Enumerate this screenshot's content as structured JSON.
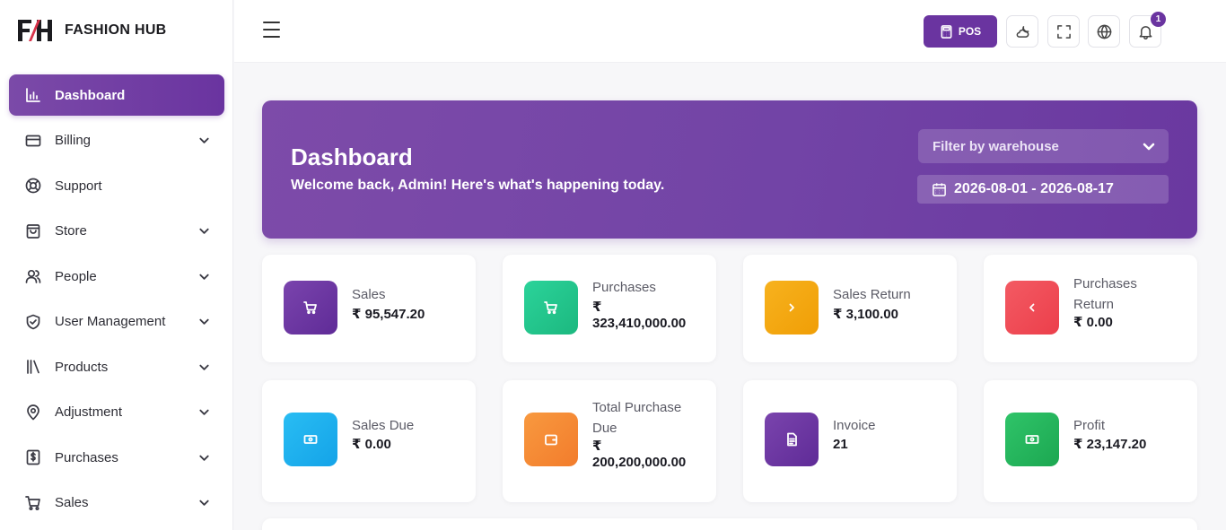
{
  "brand": {
    "logo_text": "FH",
    "name": "FASHION HUB"
  },
  "sidebar": {
    "items": [
      {
        "label": "Dashboard",
        "icon": "bar-chart-icon"
      },
      {
        "label": "Billing",
        "icon": "credit-card-icon"
      },
      {
        "label": "Support",
        "icon": "lifebuoy-icon"
      },
      {
        "label": "Store",
        "icon": "shopping-bag-icon"
      },
      {
        "label": "People",
        "icon": "users-icon"
      },
      {
        "label": "User Management",
        "icon": "shield-check-icon"
      },
      {
        "label": "Products",
        "icon": "library-icon"
      },
      {
        "label": "Adjustment",
        "icon": "map-pin-icon"
      },
      {
        "label": "Purchases",
        "icon": "dollar-receipt-icon"
      },
      {
        "label": "Sales",
        "icon": "shopping-cart-icon"
      }
    ]
  },
  "header": {
    "pos_label": "POS",
    "notification_count": "1"
  },
  "hero": {
    "title": "Dashboard",
    "subtitle": "Welcome back, Admin! Here's what's happening today.",
    "warehouse_placeholder": "Filter by warehouse",
    "date_range": "2026-08-01 - 2026-08-17"
  },
  "stats": [
    {
      "label": "Sales",
      "value": "₹ 95,547.20",
      "color": "#6a34a0"
    },
    {
      "label": "Purchases",
      "value_line1": "₹",
      "value_line2": "323,410,000.00",
      "color": "#22c58b"
    },
    {
      "label": "Sales Return",
      "value": "₹ 3,100.00",
      "color": "#f5a70f"
    },
    {
      "label_line1": "Purchases",
      "label_line2": "Return",
      "value": "₹ 0.00",
      "color": "#ef4d57"
    },
    {
      "label": "Sales Due",
      "value": "₹ 0.00",
      "color": "#1fb0ee"
    },
    {
      "label_line1": "Total Purchase",
      "label_line2": "Due",
      "value_line1": "₹",
      "value_line2": "200,200,000.00",
      "color": "#f6893c"
    },
    {
      "label": "Invoice",
      "value": "21",
      "color": "#6a34a0"
    },
    {
      "label": "Profit",
      "value": "₹ 23,147.20",
      "color": "#22b55f"
    }
  ]
}
